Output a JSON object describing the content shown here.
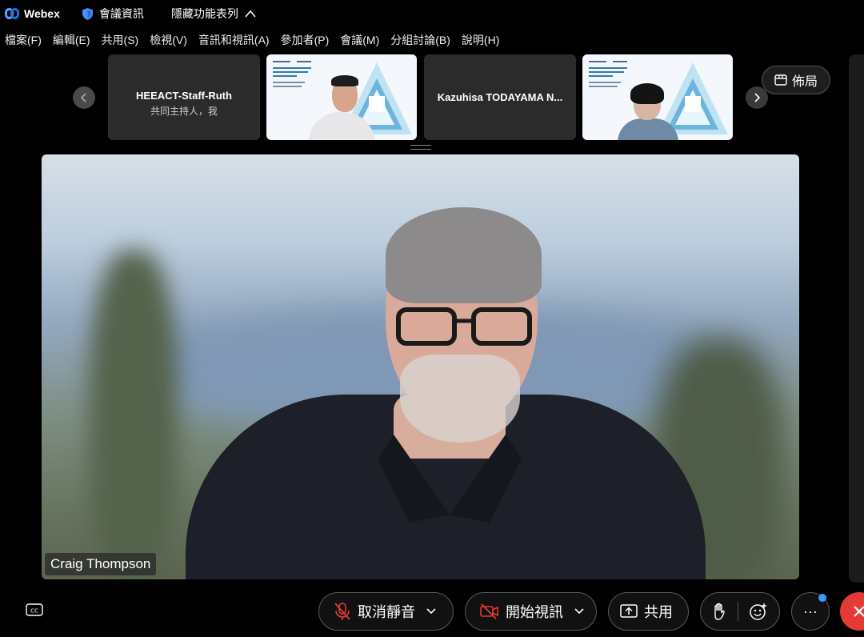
{
  "titlebar": {
    "app_name": "Webex",
    "meeting_info": "會議資訊",
    "hide_menu": "隱藏功能表列"
  },
  "menubar": {
    "items": [
      "檔案(F)",
      "編輯(E)",
      "共用(S)",
      "檢視(V)",
      "音訊和視訊(A)",
      "參加者(P)",
      "會議(M)",
      "分組討論(B)",
      "說明(H)"
    ]
  },
  "filmstrip": {
    "tiles": [
      {
        "name": "HEEACT-Staff-Ruth",
        "subtitle": "共同主持人，我"
      },
      {
        "name": "",
        "subtitle": ""
      },
      {
        "name": "Kazuhisa TODAYAMA N...",
        "subtitle": ""
      },
      {
        "name": "",
        "subtitle": ""
      }
    ],
    "layout_label": "佈局"
  },
  "main_video": {
    "speaker_name": "Craig Thompson"
  },
  "controls": {
    "mute_label": "取消靜音",
    "video_label": "開始視訊",
    "share_label": "共用",
    "more_label": "···"
  },
  "colors": {
    "accent": "#3b9dff",
    "end_call": "#e53935",
    "background": "#000000"
  }
}
